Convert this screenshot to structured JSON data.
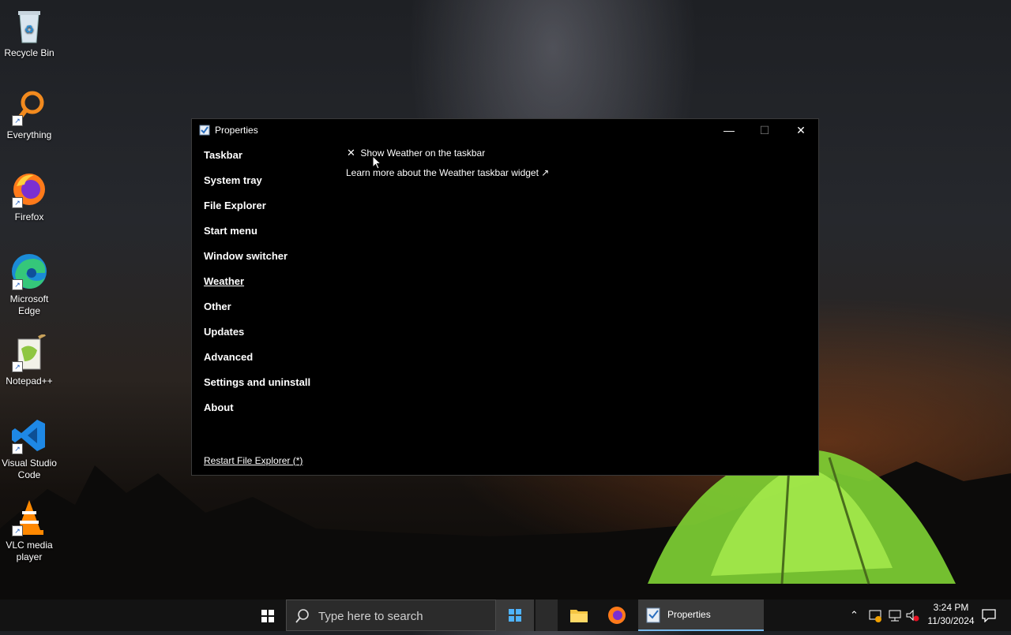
{
  "desktop": {
    "icons": [
      {
        "label": "Recycle Bin",
        "icon": "recycle-bin-icon"
      },
      {
        "label": "Everything",
        "icon": "everything-search-icon"
      },
      {
        "label": "Firefox",
        "icon": "firefox-icon"
      },
      {
        "label": "Microsoft Edge",
        "icon": "edge-icon"
      },
      {
        "label": "Notepad++",
        "icon": "notepadpp-icon"
      },
      {
        "label": "Visual Studio Code",
        "icon": "vscode-icon"
      },
      {
        "label": "VLC media player",
        "icon": "vlc-icon"
      }
    ]
  },
  "window": {
    "title": "Properties",
    "controls": {
      "minimize": "—",
      "maximize": "☐",
      "close": "✕"
    },
    "nav": [
      {
        "label": "Taskbar"
      },
      {
        "label": "System tray"
      },
      {
        "label": "File Explorer"
      },
      {
        "label": "Start menu"
      },
      {
        "label": "Window switcher"
      },
      {
        "label": "Weather",
        "active": true
      },
      {
        "label": "Other"
      },
      {
        "label": "Updates"
      },
      {
        "label": "Advanced"
      },
      {
        "label": "Settings and uninstall"
      },
      {
        "label": "About"
      }
    ],
    "restart_link": "Restart File Explorer (*)",
    "content": {
      "option_mark": "✕",
      "option_label": "Show Weather on the taskbar",
      "learn_more": "Learn more about the Weather taskbar widget ↗"
    }
  },
  "taskbar": {
    "search_placeholder": "Type here to search",
    "active_app": "Properties",
    "clock_time": "3:24 PM",
    "clock_date": "11/30/2024"
  },
  "colors": {
    "window_bg": "#000000",
    "taskbar_bg": "#141414",
    "accent": "#4cc2ff"
  }
}
